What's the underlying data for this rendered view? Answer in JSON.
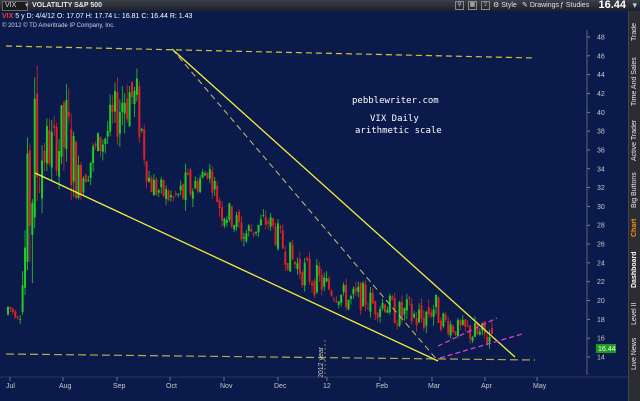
{
  "header": {
    "symbol": "VIX",
    "company": "VOLATILITY S&P 500",
    "last_price": "16.44",
    "tools": [
      "Style",
      "Drawings",
      "Studies"
    ]
  },
  "info": {
    "symbol_tag": "VIX",
    "period": "5 y D",
    "date": "4/4/12",
    "open": "O: 17.07",
    "high": "H: 17.74",
    "low": "L: 16.81",
    "close": "C: 16.44",
    "range": "R: 1.43"
  },
  "copyright": "© 2012 © TD Ameritrade IP Company, Inc.",
  "watermark": [
    "pebblewriter.com",
    "VIX Daily",
    "arithmetic scale"
  ],
  "year_marker": "2012 year",
  "sidebar": {
    "tabs": [
      "Trade",
      "Time And Sales",
      "Active Trader",
      "Big Buttons",
      "Chart",
      "Dashboard",
      "Level II",
      "Live News"
    ],
    "active": "Chart"
  },
  "colors": {
    "background": "#0a1a4a",
    "bull": "#22cc22",
    "bear": "#dd2222",
    "trendline": "#f2ef3a",
    "channel": "#e040e0",
    "price_tag": "#1e9b1e"
  },
  "chart_data": {
    "type": "candlestick",
    "ticker": "VIX",
    "interval": "daily",
    "x_labels": [
      "Jul",
      "Aug",
      "Sep",
      "Oct",
      "Nov",
      "Dec",
      "12",
      "Feb",
      "Mar",
      "Apr",
      "May"
    ],
    "y_ticks": [
      "48",
      "46",
      "44",
      "42",
      "40",
      "38",
      "36",
      "34",
      "32",
      "30",
      "28",
      "26",
      "24",
      "22",
      "20",
      "18",
      "16",
      "14"
    ],
    "ylim": [
      13,
      49
    ],
    "last_close": 16.44,
    "last_bar": {
      "open": 17.07,
      "high": 17.74,
      "low": 16.81,
      "close": 16.44
    },
    "weekly_lows": [
      18.5,
      17.8,
      22,
      32,
      34,
      31,
      30.5,
      33,
      35,
      36.5,
      38,
      37,
      31,
      30,
      29.5,
      29,
      31,
      33,
      28,
      27.5,
      25,
      26.5,
      27,
      25,
      22.5,
      21.5,
      20.5,
      20,
      19.5,
      18.5,
      19,
      18,
      18.5,
      17,
      16.5,
      16,
      17.5,
      16.5,
      16,
      15.5,
      14.5,
      14.5
    ],
    "weekly_highs": [
      20,
      19,
      45,
      40,
      39,
      43,
      35,
      37,
      39,
      42,
      47,
      44,
      34,
      33,
      32,
      34,
      34,
      35,
      32,
      30,
      29,
      29,
      30,
      28,
      26,
      25,
      24,
      23,
      22,
      21.5,
      22,
      21,
      21,
      20,
      20.5,
      20,
      21.5,
      19,
      18,
      18,
      17.8,
      17.8
    ]
  }
}
